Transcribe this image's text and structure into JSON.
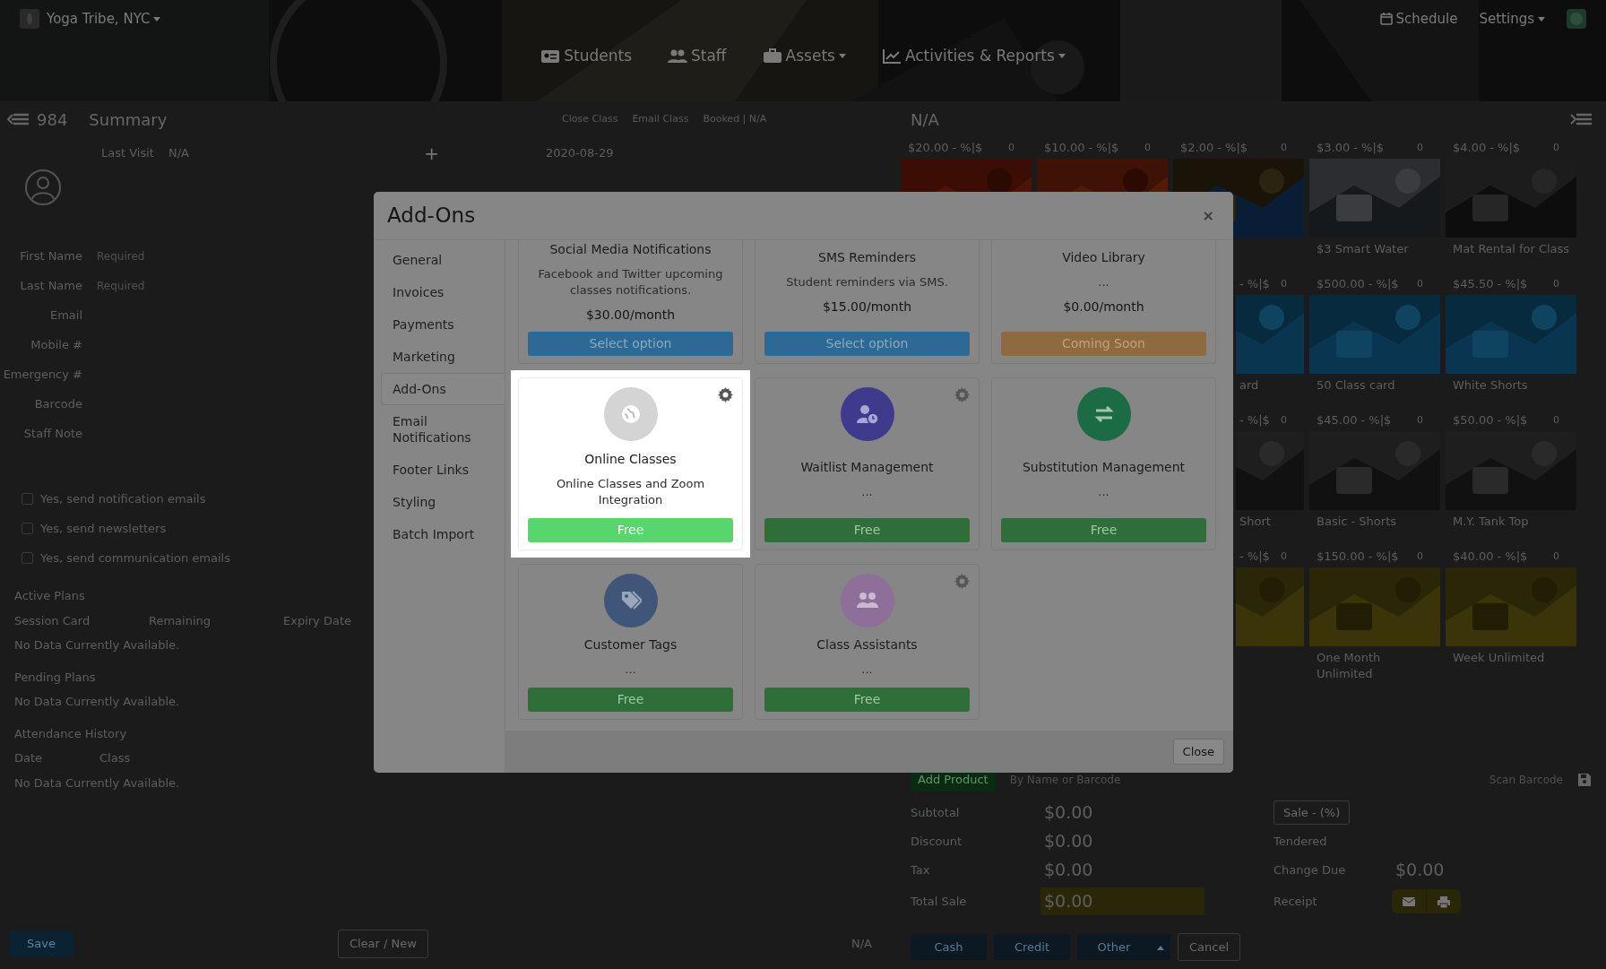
{
  "header": {
    "brand": {
      "label": "Yoga Tribe, NYC",
      "dropdown": true
    },
    "right": [
      {
        "label": "Schedule",
        "dropdown": false
      },
      {
        "label": "Settings",
        "dropdown": true
      }
    ],
    "nav": [
      {
        "label": "Students",
        "dropdown": false
      },
      {
        "label": "Staff",
        "dropdown": false
      },
      {
        "label": "Assets",
        "dropdown": true
      },
      {
        "label": "Activities & Reports",
        "dropdown": true
      }
    ]
  },
  "student": {
    "id": "984",
    "title": "Summary",
    "last_visit_label": "Last Visit",
    "last_visit": "N/A",
    "add_symbol": "+",
    "fields": [
      {
        "label": "First Name",
        "placeholder": "Required"
      },
      {
        "label": "Last Name",
        "placeholder": "Required"
      },
      {
        "label": "Email"
      },
      {
        "label": "Mobile #"
      },
      {
        "label": "Emergency #"
      },
      {
        "label": "Barcode"
      },
      {
        "label": "Staff Note"
      }
    ],
    "options": [
      {
        "label": "Yes, send notification emails",
        "checked": false
      },
      {
        "label": "Yes, send newsletters",
        "checked": false
      },
      {
        "label": "Yes, send communication emails",
        "checked": false
      }
    ],
    "sections": [
      {
        "title": "Active Plans",
        "columns": [
          "Session Card",
          "Remaining",
          "Expiry Date"
        ],
        "empty": "No Data Currently Available."
      },
      {
        "title": "Pending Plans",
        "empty": "No Data Currently Available."
      },
      {
        "title": "Attendance History",
        "columns": [
          "Date",
          "Class"
        ],
        "empty": "No Data Currently Available."
      }
    ]
  },
  "class_panel": {
    "links": [
      "Close Class",
      "Email Class",
      "Booked | N/A"
    ],
    "date": "2020-08-29"
  },
  "footer": {
    "save": "Save",
    "clear": "Clear / New",
    "status": "N/A"
  },
  "sale": {
    "title": "N/A",
    "product_rows": [
      {
        "items": [
          {
            "price": "$20.00",
            "discount": "- %|$",
            "qty": "0"
          },
          {
            "price": "$10.00",
            "discount": "- %|$",
            "qty": "0"
          },
          {
            "price": "$2.00",
            "discount": "- %|$",
            "qty": "0"
          },
          {
            "price": "$3.00",
            "discount": "- %|$",
            "qty": "0",
            "name": "$3 Smart Water"
          },
          {
            "price": "$4.00",
            "discount": "- %|$",
            "qty": "0",
            "name": "Mat Rental for Class"
          }
        ]
      },
      {
        "items": [
          {
            "discount": "- %|$",
            "qty": "0",
            "name": "ard"
          },
          {
            "price": "$500.00",
            "discount": "- %|$",
            "qty": "0",
            "name": "50 Class card"
          },
          {
            "price": "$45.50",
            "discount": "- %|$",
            "qty": "0",
            "name": "White Shorts"
          }
        ]
      },
      {
        "items": [
          {
            "discount": "- %|$",
            "qty": "0",
            "name": "Short"
          },
          {
            "price": "$45.00",
            "discount": "- %|$",
            "qty": "0",
            "name": "Basic - Shorts"
          },
          {
            "price": "$50.00",
            "discount": "- %|$",
            "qty": "0",
            "name": "M.Y. Tank Top"
          }
        ]
      },
      {
        "items": [
          {
            "discount": "- %|$",
            "qty": "0"
          },
          {
            "price": "$150.00",
            "discount": "- %|$",
            "qty": "0",
            "name": "One Month Unlimited"
          },
          {
            "price": "$40.00",
            "discount": "- %|$",
            "qty": "0",
            "name": "Week Unlimited"
          }
        ]
      }
    ],
    "add_product": "Add Product",
    "search_placeholder": "By Name or Barcode",
    "scan_placeholder": "Scan Barcode",
    "totals": [
      {
        "label": "Subtotal",
        "value": "$0.00"
      },
      {
        "label": "Discount",
        "value": "$0.00"
      },
      {
        "label": "Tax",
        "value": "$0.00"
      },
      {
        "label": "Total Sale",
        "value": "$0.00"
      }
    ],
    "sale_button": "Sale - (%)",
    "tendered_label": "Tendered",
    "change_label": "Change Due",
    "change_value": "$0.00",
    "receipt_label": "Receipt",
    "pay_buttons": [
      "Cash",
      "Credit",
      "Other"
    ],
    "cancel": "Cancel"
  },
  "modal": {
    "title": "Add-Ons",
    "close_symbol": "×",
    "menu": [
      {
        "label": "General",
        "selected": false
      },
      {
        "label": "Invoices",
        "selected": false
      },
      {
        "label": "Payments",
        "selected": false
      },
      {
        "label": "Marketing",
        "selected": false
      },
      {
        "label": "Add-Ons",
        "selected": true
      },
      {
        "label": "Email Notifications",
        "selected": false
      },
      {
        "label": "Footer Links",
        "selected": false
      },
      {
        "label": "Styling",
        "selected": false
      },
      {
        "label": "Batch Import",
        "selected": false
      }
    ],
    "addons": [
      {
        "title": "Social Media Notifications",
        "description": "Facebook and Twitter upcoming classes notifications.",
        "price": "$30.00/month",
        "action": {
          "label": "Select option",
          "kind": "select"
        },
        "settings": false,
        "highlighted": false
      },
      {
        "title": "SMS Reminders",
        "description": "Student reminders via SMS.",
        "price": "$15.00/month",
        "action": {
          "label": "Select option",
          "kind": "select"
        },
        "settings": false,
        "highlighted": false
      },
      {
        "title": "Video Library",
        "description": "...",
        "price": "$0.00/month",
        "action": {
          "label": "Coming Soon",
          "kind": "soon"
        },
        "settings": false,
        "highlighted": false
      },
      {
        "title": "Online Classes",
        "description": "Online Classes and Zoom Integration",
        "color": "#d4d4d4",
        "action": {
          "label": "Free",
          "kind": "free"
        },
        "settings": true,
        "highlighted": true
      },
      {
        "title": "Waitlist Management",
        "description": "...",
        "color": "#3e3a8c",
        "action": {
          "label": "Free",
          "kind": "free"
        },
        "settings": true,
        "highlighted": false
      },
      {
        "title": "Substitution Management",
        "description": "...",
        "color": "#1b6b45",
        "action": {
          "label": "Free",
          "kind": "free"
        },
        "settings": false,
        "highlighted": false
      },
      {
        "title": "Customer Tags",
        "description": "...",
        "color": "#405678",
        "action": {
          "label": "Free",
          "kind": "free"
        },
        "settings": false,
        "highlighted": false
      },
      {
        "title": "Class Assistants",
        "description": "...",
        "color": "#8e6f9a",
        "action": {
          "label": "Free",
          "kind": "free"
        },
        "settings": true,
        "highlighted": false
      }
    ],
    "close": "Close"
  }
}
